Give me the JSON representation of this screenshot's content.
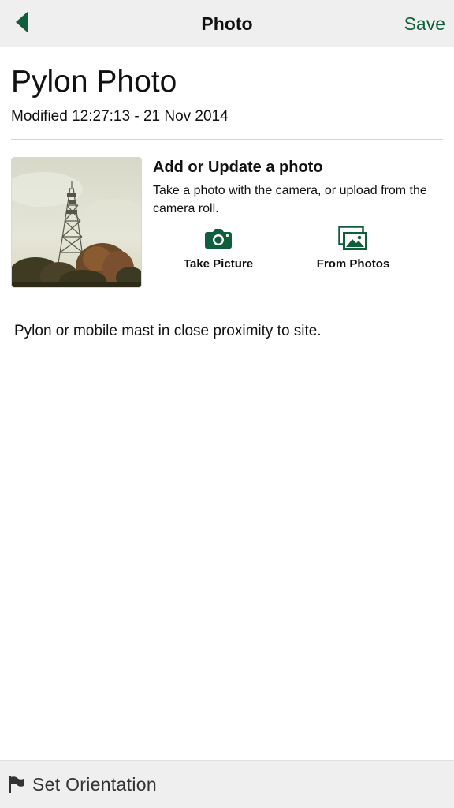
{
  "nav": {
    "title": "Photo",
    "save_label": "Save",
    "back_icon": "chevron-left-icon"
  },
  "header": {
    "title": "Pylon Photo",
    "modified": "Modified 12:27:13 - 21 Nov 2014"
  },
  "photo_section": {
    "heading": "Add or Update a photo",
    "description": "Take a photo with the camera, or upload from the camera roll.",
    "actions": [
      {
        "label": "Take Picture",
        "icon": "camera-icon"
      },
      {
        "label": "From Photos",
        "icon": "photos-icon"
      }
    ]
  },
  "description": "Pylon or mobile mast in close proximity to site.",
  "bottom_bar": {
    "label": "Set  Orientation",
    "icon": "flag-icon"
  },
  "colors": {
    "accent": "#0f5f3c",
    "bar_background": "#efefef",
    "divider": "#d4d4d4"
  }
}
